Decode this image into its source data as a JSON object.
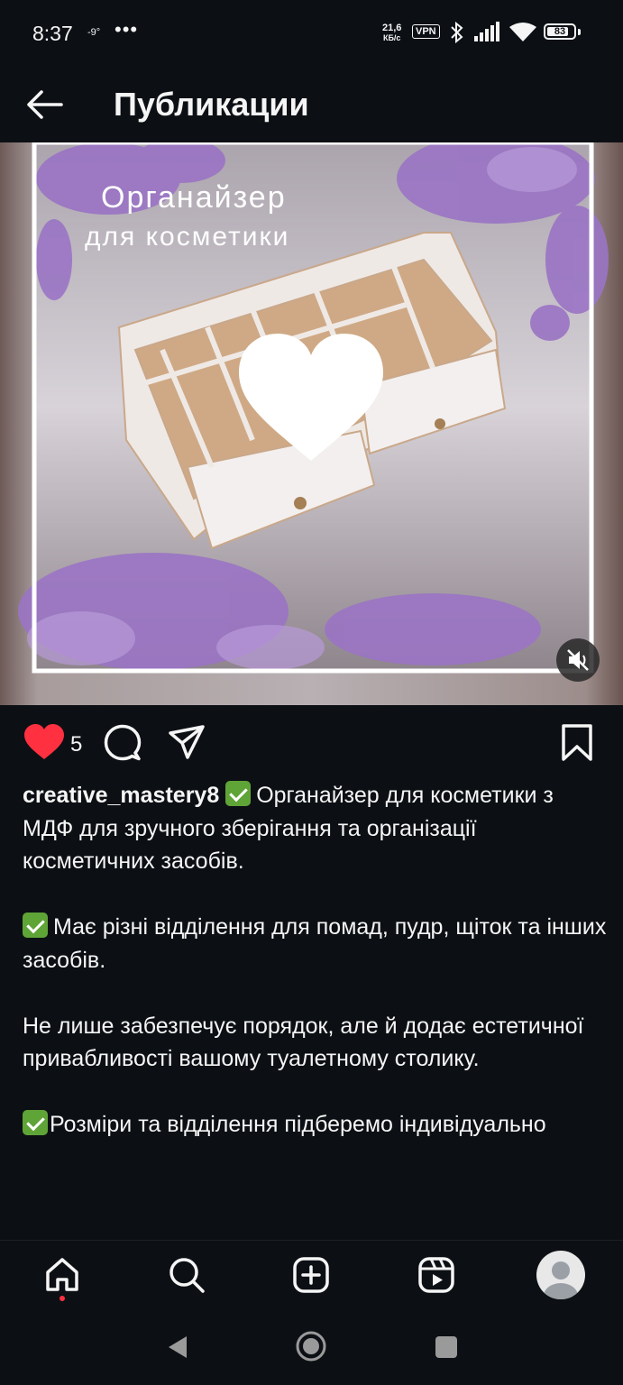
{
  "status_bar": {
    "time": "8:37",
    "temperature": "-9°",
    "dots": "•••",
    "speed_value": "21,6",
    "speed_unit": "КБ/с",
    "vpn": "VPN",
    "battery": "83",
    "battery_fraction": 0.83
  },
  "header": {
    "title": "Публикации"
  },
  "post": {
    "overlay_title": "Органайзер",
    "overlay_subtitle": "для косметики",
    "like_count": "5",
    "username": "creative_mastery8",
    "caption_1": "Органайзер для косметики з МДФ для зручного зберігання та організації косметичних засобів.",
    "caption_2": "Має різні відділення для помад, пудр, щіток та інших засобів.",
    "caption_3": "Не лише забезпечує порядок, але й додає естетичної привабливості вашому туалетному столику.",
    "caption_4": "Розміри та відділення підберемо індивідуально"
  },
  "colors": {
    "background": "#0c1014",
    "like": "#ff3040",
    "check": "#5fa437",
    "lavender": "#9a74c4"
  },
  "icons": {
    "back": "arrow-left-icon",
    "mute": "speaker-muted-icon",
    "like": "heart-icon",
    "comment": "comment-icon",
    "share": "paper-plane-icon",
    "save": "bookmark-icon",
    "home": "home-icon",
    "search": "search-icon",
    "create": "plus-square-icon",
    "reels": "reels-icon",
    "profile": "avatar",
    "sys_back": "triangle-back-icon",
    "sys_home": "circle-home-icon",
    "sys_recents": "square-recents-icon"
  }
}
